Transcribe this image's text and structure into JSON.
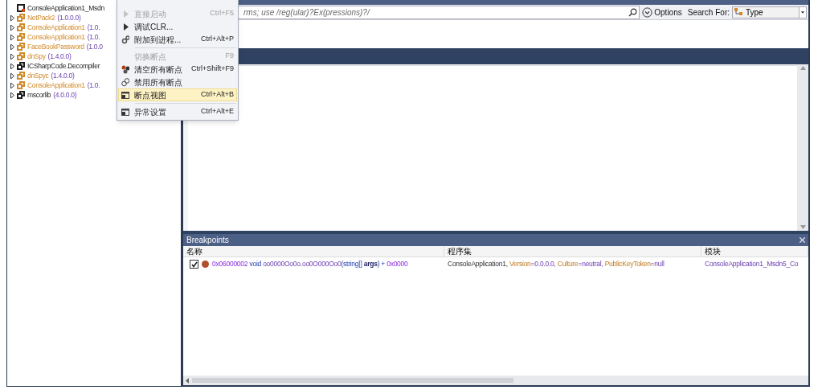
{
  "tree": {
    "items": [
      {
        "kind": "module",
        "name": "ConsoleApplication1_Msdn",
        "color": "#1e1e1e"
      },
      {
        "kind": "assembly",
        "name": "NetPack2",
        "version": "(1.0.0.0)",
        "color": "#d08a2a",
        "expanded": false
      },
      {
        "kind": "assembly",
        "name": "ConsoleApplication1",
        "version": "(1.0.",
        "color": "#d08a2a",
        "expanded": false
      },
      {
        "kind": "assembly",
        "name": "ConsoleApplication1",
        "version": "(1.0.",
        "color": "#d08a2a",
        "expanded": false
      },
      {
        "kind": "assembly",
        "name": "FaceBookPassword",
        "version": "(1.0.0",
        "color": "#d08a2a",
        "expanded": false
      },
      {
        "kind": "assembly",
        "name": "dnSpy",
        "version": "(1.4.0.0)",
        "color": "#d08a2a",
        "expanded": false
      },
      {
        "kind": "assembly",
        "name": "ICSharpCode.Decompiler",
        "color": "#1e1e1e",
        "expanded": false
      },
      {
        "kind": "assembly",
        "name": "dnSpyc",
        "version": "(1.4.0.0)",
        "color": "#d08a2a",
        "expanded": false
      },
      {
        "kind": "assembly",
        "name": "ConsoleApplication1",
        "version": "(1.0.",
        "color": "#d08a2a",
        "expanded": false
      },
      {
        "kind": "assembly",
        "name": "mscorlib",
        "version": "(4.0.0.0)",
        "color": "#1e1e1e",
        "expanded": false
      }
    ]
  },
  "menu": {
    "items": [
      {
        "kind": "item",
        "label": "直接启动",
        "shortcut": "Ctrl+F5",
        "disabled": true,
        "selected": false
      },
      {
        "kind": "item",
        "label": "调试CLR...",
        "disabled": false,
        "selected": false
      },
      {
        "kind": "item",
        "label": "附加到进程...",
        "shortcut": "Ctrl+Alt+P",
        "disabled": false,
        "selected": false
      },
      {
        "kind": "separator"
      },
      {
        "kind": "item",
        "label": "切换断点",
        "shortcut": "F9",
        "disabled": true,
        "selected": false
      },
      {
        "kind": "item",
        "label": "清空所有断点",
        "shortcut": "Ctrl+Shift+F9",
        "disabled": false,
        "selected": false
      },
      {
        "kind": "item",
        "label": "禁用所有断点",
        "disabled": false,
        "selected": false
      },
      {
        "kind": "item",
        "label": "断点视图",
        "shortcut": "Ctrl+Alt+B",
        "disabled": false,
        "selected": true
      },
      {
        "kind": "separator"
      },
      {
        "kind": "item",
        "label": "异常设置",
        "shortcut": "Ctrl+Alt+E",
        "disabled": false,
        "selected": false
      }
    ]
  },
  "search": {
    "placeholder": "rms; use /reg(ular)?Ex(pressions)?/",
    "options_label": "Options",
    "search_for_label": "Search For:",
    "search_for_value": "Type"
  },
  "breakpoints": {
    "title": "Breakpoints",
    "columns": [
      "名称",
      "程序集",
      "模块"
    ],
    "rows": [
      {
        "checked": true,
        "name": [
          {
            "kind": "number",
            "text": "0x06000002 "
          },
          {
            "kind": "keyword",
            "text": "void "
          },
          {
            "kind": "member",
            "text": "oo0000Oo0o.oo0O000Oo0"
          },
          {
            "kind": "keyword",
            "text": "(string[] "
          },
          {
            "kind": "parameter",
            "text": "args"
          },
          {
            "kind": "keyword",
            "text": ") + "
          },
          {
            "kind": "number",
            "text": "0x0000"
          }
        ],
        "assembly": [
          {
            "kind": "plain",
            "text": "ConsoleApplication1, "
          },
          {
            "kind": "key",
            "text": "Version"
          },
          {
            "kind": "value",
            "text": "=0.0.0.0, "
          },
          {
            "kind": "key",
            "text": "Culture"
          },
          {
            "kind": "value",
            "text": "=neutral, "
          },
          {
            "kind": "key",
            "text": "PublicKeyToken"
          },
          {
            "kind": "value",
            "text": "=null"
          }
        ],
        "module": "ConsoleApplication1_Msdn5_Co"
      }
    ]
  }
}
